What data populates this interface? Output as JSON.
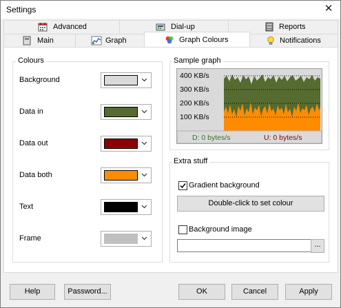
{
  "window": {
    "title": "Settings",
    "close": "✕"
  },
  "tabs_back": [
    {
      "label": "Advanced"
    },
    {
      "label": "Dial-up"
    },
    {
      "label": "Reports"
    }
  ],
  "tabs_front": [
    {
      "label": "Main"
    },
    {
      "label": "Graph"
    },
    {
      "label": "Graph Colours"
    },
    {
      "label": "Notifications"
    }
  ],
  "colours": {
    "group_label": "Colours",
    "items": [
      {
        "label": "Background",
        "color": "#dadada"
      },
      {
        "label": "Data in",
        "color": "#556b2f"
      },
      {
        "label": "Data out",
        "color": "#8b0000"
      },
      {
        "label": "Data both",
        "color": "#ff8c00"
      },
      {
        "label": "Text",
        "color": "#000000"
      },
      {
        "label": "Frame",
        "color": "#c0c0c0"
      }
    ]
  },
  "sample": {
    "group_label": "Sample graph",
    "ticks": [
      "400 KB/s",
      "300 KB/s",
      "200 KB/s",
      "100 KB/s"
    ],
    "download": "D: 0 bytes/s",
    "upload": "U: 0 bytes/s",
    "download_color": "#3c6e2a",
    "upload_color": "#8b0000"
  },
  "extra": {
    "group_label": "Extra stuff",
    "gradient_label": "Gradient background",
    "gradient_checked": true,
    "set_colour_button": "Double-click to set colour",
    "bg_image_label": "Background image",
    "bg_image_checked": false,
    "bg_image_value": "",
    "browse_button": "..."
  },
  "footer": {
    "help": "Help",
    "password": "Password...",
    "ok": "OK",
    "cancel": "Cancel",
    "apply": "Apply"
  }
}
